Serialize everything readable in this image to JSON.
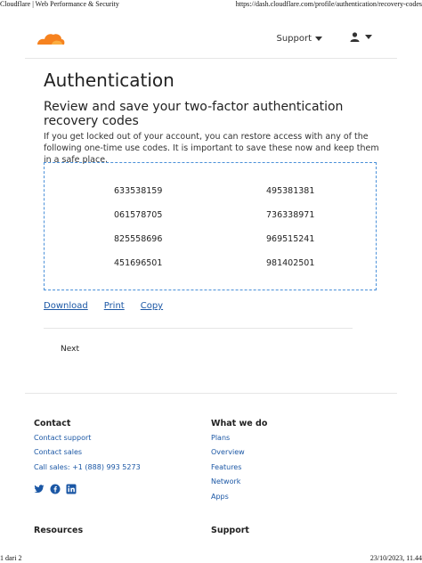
{
  "print": {
    "header_left": "Cloudflare | Web Performance & Security",
    "header_right": "https://dash.cloudflare.com/profile/authentication/recovery-codes",
    "footer_left": "1 dari 2",
    "footer_right": "23/10/2023, 11.44"
  },
  "topbar": {
    "support_label": "Support",
    "brand_color": "#f6821f"
  },
  "page": {
    "title": "Authentication",
    "subtitle": "Review and save your two-factor authentication recovery codes",
    "description": "If you get locked out of your account, you can restore access with any of the following one-time use codes. It is important to save these now and keep them in a safe place."
  },
  "codes": [
    [
      "633538159",
      "495381381"
    ],
    [
      "061578705",
      "736338971"
    ],
    [
      "825558696",
      "969515241"
    ],
    [
      "451696501",
      "981402501"
    ]
  ],
  "actions": {
    "download": "Download",
    "print": "Print",
    "copy": "Copy"
  },
  "next_label": "Next",
  "footer": {
    "contact_heading": "Contact",
    "contact_links": [
      "Contact support",
      "Contact sales",
      "Call sales: +1 (888) 993 5273"
    ],
    "whatwedo_heading": "What we do",
    "whatwedo_links": [
      "Plans",
      "Overview",
      "Features",
      "Network",
      "Apps"
    ],
    "resources_heading": "Resources",
    "support_heading": "Support",
    "social_icons": [
      "twitter-icon",
      "facebook-icon",
      "linkedin-icon"
    ]
  }
}
